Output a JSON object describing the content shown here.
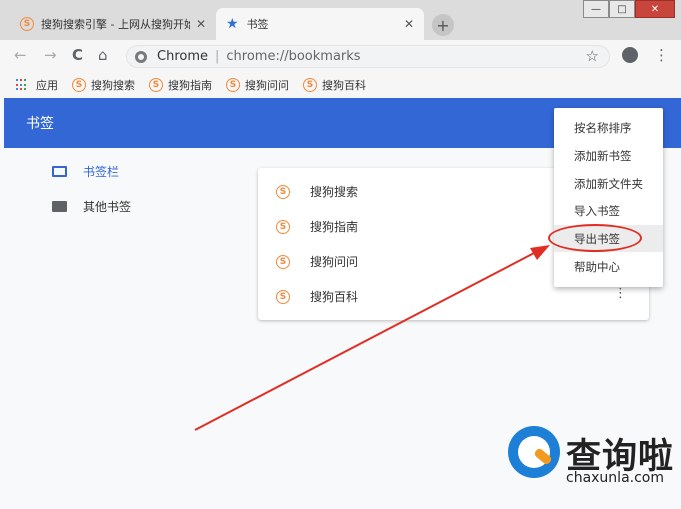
{
  "tabs": [
    {
      "title": "搜狗搜索引擎 - 上网从搜狗开始",
      "icon": "sogou-icon",
      "close": "✕"
    },
    {
      "title": "书签",
      "icon": "star-icon",
      "close": "✕"
    }
  ],
  "new_tab": "+",
  "window_controls": {
    "minimize": "—",
    "maximize": "□",
    "close": "✕"
  },
  "toolbar": {
    "back": "←",
    "forward": "→",
    "reload": "C",
    "home": "⌂",
    "site_label": "Chrome",
    "url": "chrome://bookmarks",
    "star": "☆",
    "menu": "⋮"
  },
  "bookmarks_bar": {
    "apps_label": "应用",
    "items": [
      "搜狗搜索",
      "搜狗指南",
      "搜狗问问",
      "搜狗百科"
    ]
  },
  "header": {
    "title": "书签"
  },
  "sidebar": {
    "items": [
      {
        "label": "书签栏",
        "active": true
      },
      {
        "label": "其他书签",
        "active": false
      }
    ]
  },
  "list": {
    "rows": [
      {
        "label": "搜狗搜索"
      },
      {
        "label": "搜狗指南"
      },
      {
        "label": "搜狗问问"
      },
      {
        "label": "搜狗百科"
      }
    ],
    "more": "⋮"
  },
  "menu": {
    "items": [
      "按名称排序",
      "添加新书签",
      "添加新文件夹",
      "导入书签",
      "导出书签",
      "帮助中心"
    ],
    "highlighted": "导出书签"
  },
  "watermark": {
    "brand": "查询啦",
    "domain": "chaxunla.com"
  },
  "colors": {
    "accent": "#3367d6",
    "annotation": "#e02e24",
    "sogou": "#f08a3c"
  }
}
